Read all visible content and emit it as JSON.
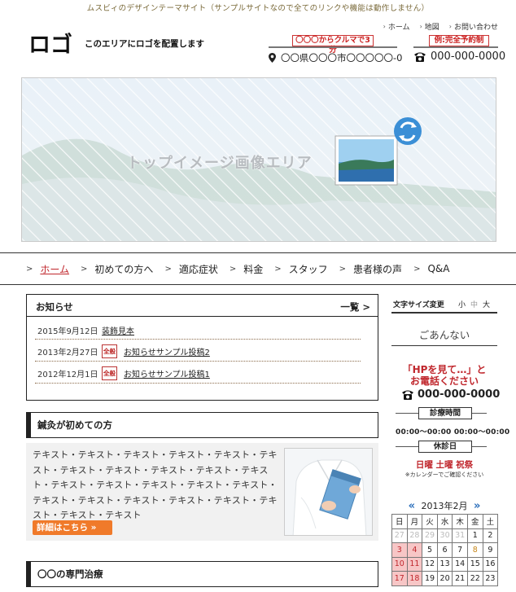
{
  "header": {
    "tagline": "ムスビィのデザインテーマサイト（サンプルサイトなので全てのリンクや機能は動作しません）",
    "util_nav": [
      {
        "label": "ホーム"
      },
      {
        "label": "地図"
      },
      {
        "label": "お問い合わせ"
      }
    ],
    "logo_text": "ロゴ",
    "logo_note": "このエリアにロゴを配置します",
    "access_badge": "〇〇〇からクルマで3分",
    "address": "〇〇県〇〇〇市〇〇〇〇〇-0",
    "reserve_badge": "例:完全予約制",
    "phone": "000-000-0000"
  },
  "hero": {
    "text": "トップイメージ画像エリア"
  },
  "gnav": {
    "items": [
      {
        "label": "ホーム",
        "active": true
      },
      {
        "label": "初めての方へ"
      },
      {
        "label": "適応症状"
      },
      {
        "label": "料金"
      },
      {
        "label": "スタッフ"
      },
      {
        "label": "患者様の声"
      },
      {
        "label": "Q&A"
      }
    ]
  },
  "news": {
    "title": "お知らせ",
    "more": "一覧",
    "rows": [
      {
        "date": "2015年9月12日",
        "category": "",
        "title": "装飾見本"
      },
      {
        "date": "2013年2月27日",
        "category": "全般",
        "title": "お知らせサンプル投稿2"
      },
      {
        "date": "2012年12月1日",
        "category": "全般",
        "title": "お知らせサンプル投稿1"
      }
    ]
  },
  "first_time": {
    "heading": "鍼灸が初めての方",
    "text": "テキスト・テキスト・テキスト・テキスト・テキスト・テキスト・テキスト・テキスト・テキスト・テキスト・テキスト・テキスト・テキスト・テキスト・テキスト・テキスト・テキスト・テキスト・テキスト・テキスト・テキスト・テキスト・テキスト・テキスト",
    "button": "詳細はこちら »"
  },
  "specialty": {
    "heading": "〇〇の専門治療"
  },
  "sidebar": {
    "font_size_label": "文字サイズ変更",
    "font_sizes": [
      "小",
      "中",
      "大"
    ],
    "guide": "ごあんない",
    "cta_line1": "「HPを見て…」と",
    "cta_line2": "お電話ください",
    "phone": "000-000-0000",
    "hours_label": "診療時間",
    "hours": "00:00～00:00 00:00～00:00",
    "holiday_label": "休診日",
    "holidays": "日曜 土曜 祝祭",
    "holiday_note": "※カレンダーでご確認ください"
  },
  "calendar": {
    "month": "2013年2月",
    "prev": "«",
    "next": "»",
    "weekdays": [
      "日",
      "月",
      "火",
      "水",
      "木",
      "金",
      "土"
    ],
    "weeks": [
      [
        {
          "d": "27",
          "t": "dim"
        },
        {
          "d": "28",
          "t": "dim"
        },
        {
          "d": "29",
          "t": "dim"
        },
        {
          "d": "30",
          "t": "dim"
        },
        {
          "d": "31",
          "t": "dim"
        },
        {
          "d": "1"
        },
        {
          "d": "2"
        }
      ],
      [
        {
          "d": "3",
          "t": "hol"
        },
        {
          "d": "4",
          "t": "hol"
        },
        {
          "d": "5"
        },
        {
          "d": "6"
        },
        {
          "d": "7"
        },
        {
          "d": "8",
          "t": "spc"
        },
        {
          "d": "9"
        }
      ],
      [
        {
          "d": "10",
          "t": "hol"
        },
        {
          "d": "11",
          "t": "hol"
        },
        {
          "d": "12"
        },
        {
          "d": "13"
        },
        {
          "d": "14"
        },
        {
          "d": "15"
        },
        {
          "d": "16"
        }
      ],
      [
        {
          "d": "17",
          "t": "hol"
        },
        {
          "d": "18",
          "t": "hol"
        },
        {
          "d": "19"
        },
        {
          "d": "20"
        },
        {
          "d": "21"
        },
        {
          "d": "22"
        },
        {
          "d": "23"
        }
      ]
    ]
  },
  "colors": {
    "accent_red": "#c0272d",
    "button_orange": "#f07a2a",
    "calendar_nav_blue": "#2a6ebb"
  }
}
